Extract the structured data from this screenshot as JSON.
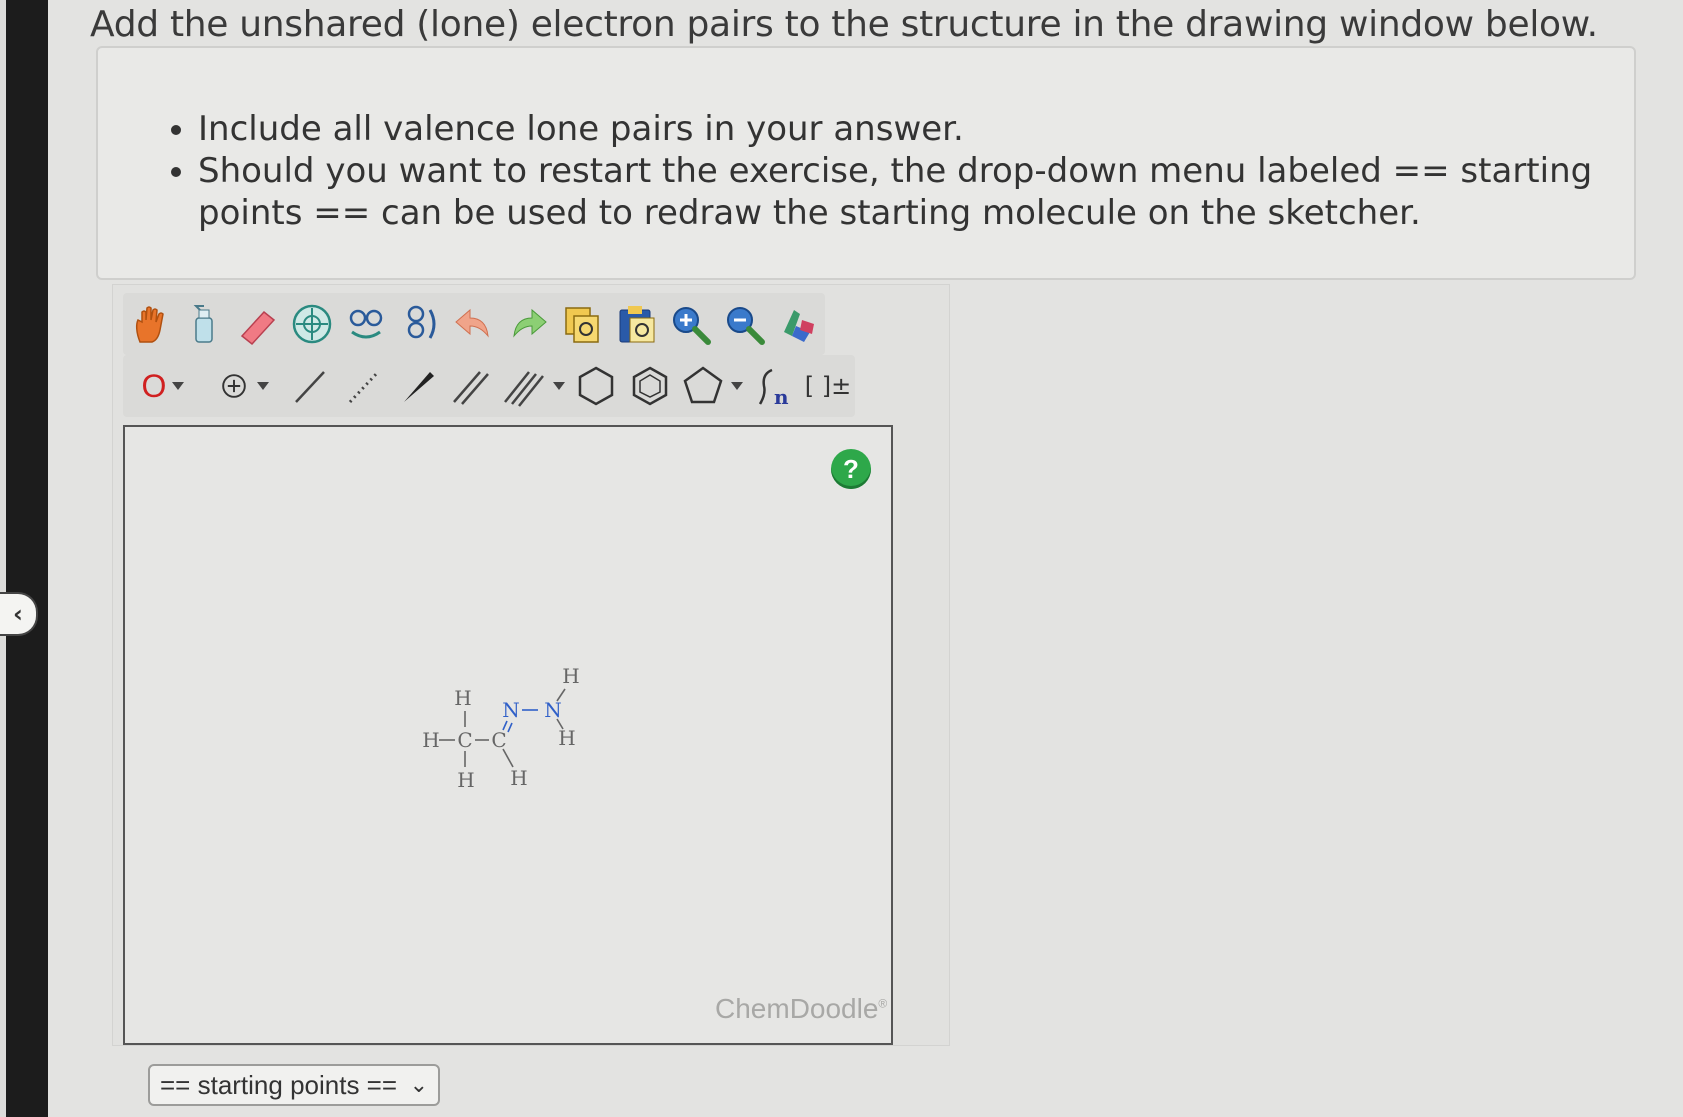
{
  "page": {
    "title": "Add the unshared (lone) electron pairs to the structure in the drawing window below."
  },
  "instructions": [
    "Include all valence lone pairs in your answer.",
    "Should you want to restart the exercise, the drop-down menu labeled == starting points == can be used to redraw the starting molecule on the sketcher."
  ],
  "toolbar": {
    "row1": [
      "hand-icon",
      "spray-bottle-icon",
      "eraser-icon",
      "center-icon",
      "flip-horizontal-icon",
      "flip-vertical-icon",
      "undo-icon",
      "redo-icon",
      "copy-icon",
      "paste-icon",
      "zoom-in-icon",
      "zoom-out-icon",
      "clean-structure-icon"
    ],
    "row2": [
      "atom-label-select",
      "charge-select",
      "single-bond",
      "stereo-hash-bond",
      "stereo-wedge-bond",
      "double-bond",
      "triple-bond-dropdown",
      "cyclohexane-ring",
      "benzene-ring",
      "cyclopentane-ring-dropdown",
      "repeat-unit",
      "bracket-charge"
    ],
    "atom_label": "O",
    "repeat_label": "n",
    "bracket_label": "[ ]±"
  },
  "sketcher": {
    "help_label": "?",
    "watermark": "ChemDoodle",
    "watermark_mark": "®",
    "molecule": {
      "atoms": [
        "H",
        "H",
        "C",
        "H",
        "C",
        "H",
        "N",
        "N",
        "H",
        "H"
      ],
      "bonds": [
        "H-C",
        "H-C",
        "H-C",
        "C-C",
        "C=N",
        "C-H",
        "N-N",
        "N-H",
        "N-H"
      ]
    }
  },
  "dropdown": {
    "label": "== starting points =="
  },
  "colors": {
    "nitrogen": "#3060c8",
    "carbon": "#666666",
    "hydrogen": "#666666",
    "help": "#2ea84a",
    "atom_select": "#d02020"
  }
}
